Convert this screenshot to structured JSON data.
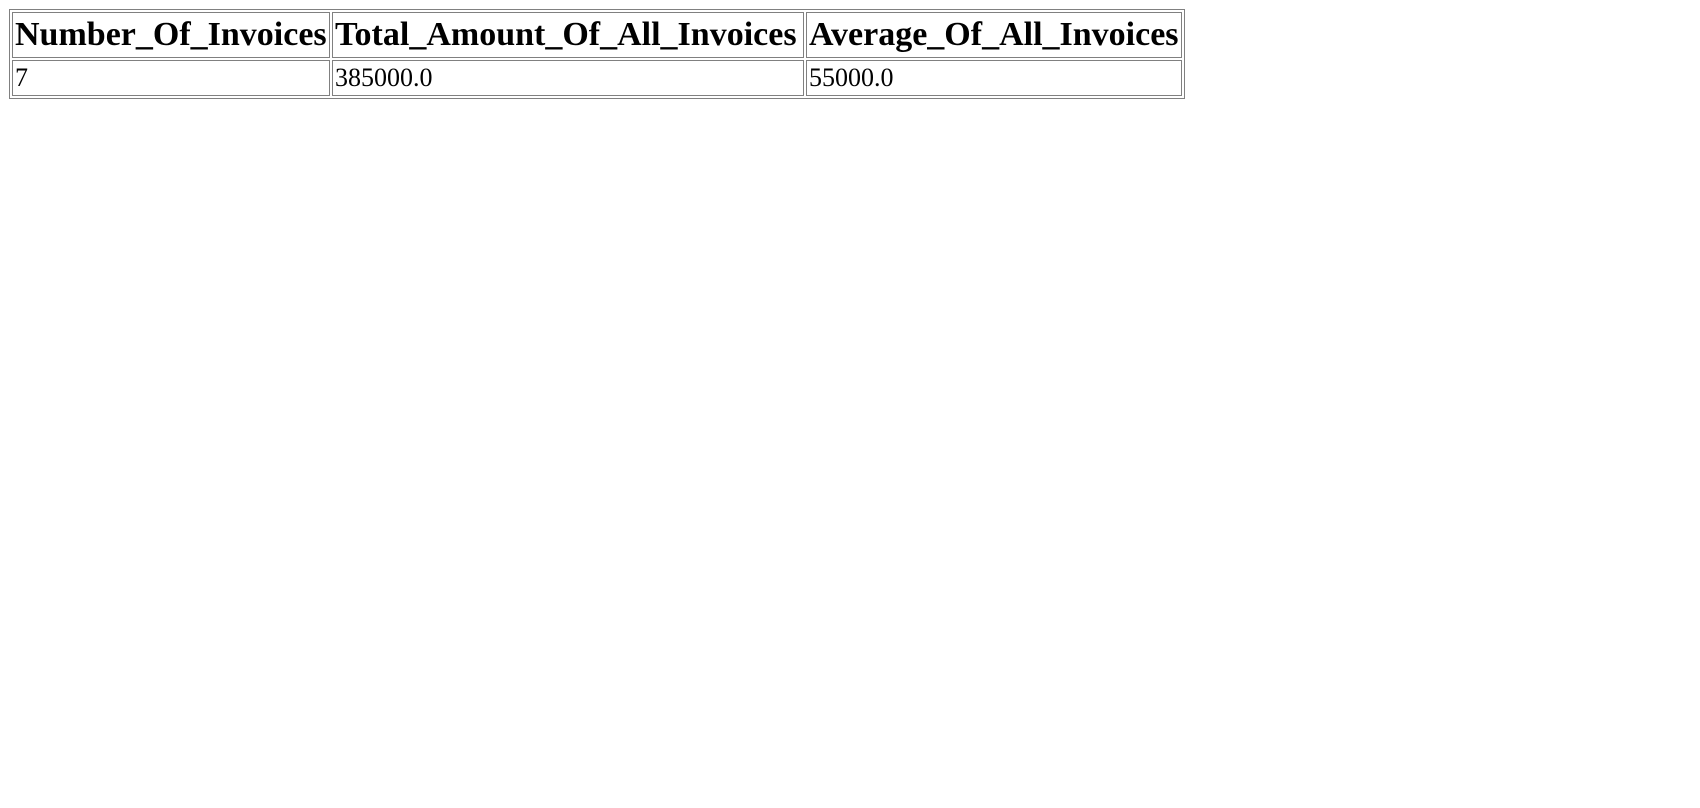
{
  "table": {
    "headers": [
      "Number_Of_Invoices",
      "Total_Amount_Of_All_Invoices",
      "Average_Of_All_Invoices"
    ],
    "rows": [
      [
        "7",
        "385000.0",
        "55000.0"
      ]
    ]
  }
}
